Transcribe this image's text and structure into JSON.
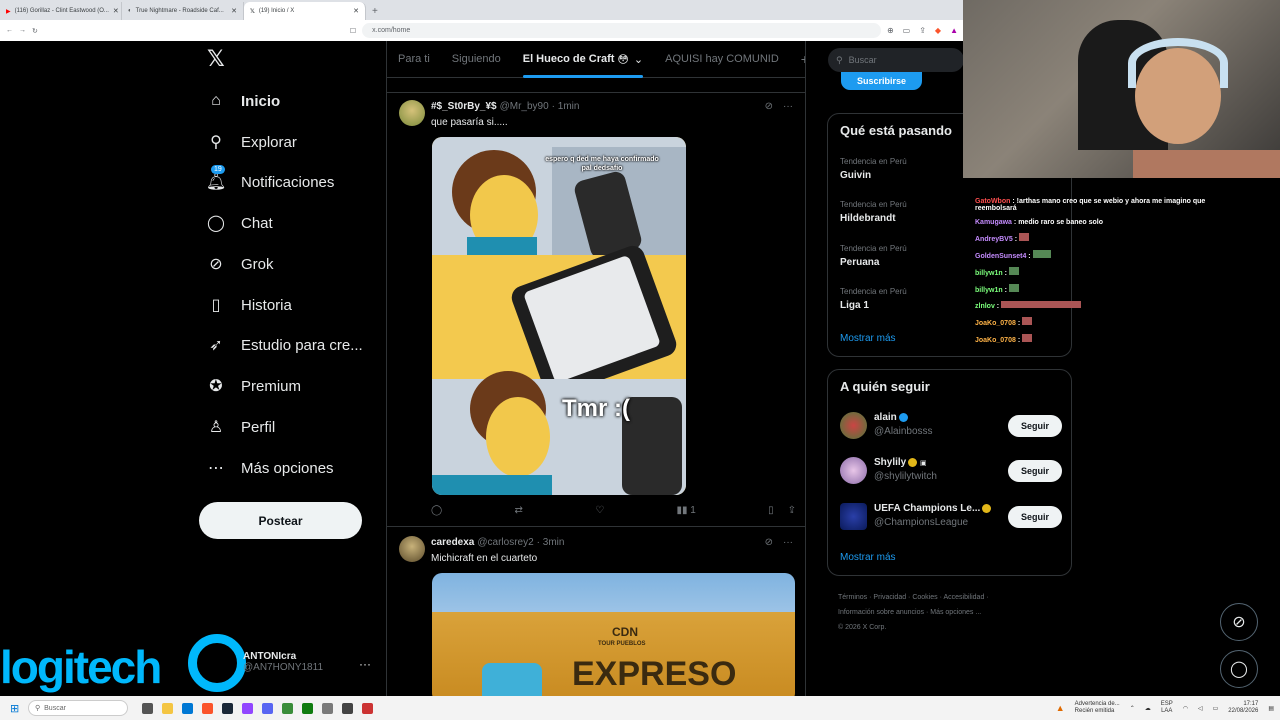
{
  "browser": {
    "tabs": [
      {
        "label": "(116) Gorillaz - Clint Eastwood (O..."
      },
      {
        "label": "True Nightmare - Roadside Caf..."
      },
      {
        "label": "(19) Inicio / X"
      }
    ],
    "url": "x.com/home"
  },
  "nav": {
    "items": [
      {
        "label": "Inicio",
        "icon": "home-icon"
      },
      {
        "label": "Explorar",
        "icon": "search-icon"
      },
      {
        "label": "Notificaciones",
        "icon": "bell-icon",
        "badge": "19"
      },
      {
        "label": "Chat",
        "icon": "chat-icon"
      },
      {
        "label": "Grok",
        "icon": "grok-icon"
      },
      {
        "label": "Historia",
        "icon": "bookmark-icon"
      },
      {
        "label": "Estudio para cre...",
        "icon": "rocket-icon"
      },
      {
        "label": "Premium",
        "icon": "verified-icon"
      },
      {
        "label": "Perfil",
        "icon": "person-icon"
      },
      {
        "label": "Más opciones",
        "icon": "more-icon"
      }
    ],
    "post_button": "Postear",
    "profile_name": "ANTONIcra",
    "profile_handle": "@AN7HONY1811"
  },
  "overlay": {
    "logitech": "logitech"
  },
  "feed": {
    "tabs": [
      "Para ti",
      "Siguiendo",
      "El Hueco de Craft",
      "AQUISI hay COMUNID"
    ],
    "tweets": [
      {
        "name": "#$_St0rBy_¥$",
        "handle": "@Mr_by90",
        "time": "· 1min",
        "text": "que pasaría si.....",
        "meme_top": "espero q ded me haya confirmado pal dedsafio",
        "meme_bottom": "Tmr :(",
        "views": "1"
      },
      {
        "name": "caredexa",
        "handle": "@carlosrey2",
        "time": "· 3min",
        "text": "Michicraft en el cuarteto",
        "sign_text": "CDN",
        "sign_sub": "TOUR PUEBLOS",
        "sign_big": "EXPRESO"
      }
    ]
  },
  "right": {
    "search_placeholder": "Buscar",
    "subscribe": "Suscribirse",
    "trends_title": "Qué está pasando",
    "trends": [
      {
        "context": "Tendencia en Perú",
        "name": "Guivin"
      },
      {
        "context": "Tendencia en Perú",
        "name": "Hildebrandt"
      },
      {
        "context": "Tendencia en Perú",
        "name": "Peruana"
      },
      {
        "context": "Tendencia en Perú",
        "name": "Liga 1"
      }
    ],
    "show_more": "Mostrar más",
    "follow_title": "A quién seguir",
    "follow": [
      {
        "name": "alain",
        "handle": "@Alainbosss",
        "button": "Seguir"
      },
      {
        "name": "Shylily",
        "handle": "@shylilytwitch",
        "button": "Seguir"
      },
      {
        "name": "UEFA Champions Le...",
        "handle": "@ChampionsLeague",
        "button": "Seguir"
      }
    ],
    "follow_more": "Mostrar más",
    "footer": [
      "Términos",
      "Privacidad",
      "Cookies",
      "Accesibilidad",
      "Información sobre anuncios",
      "Más opciones ...",
      "© 2026 X Corp."
    ]
  },
  "stream_chat": [
    {
      "user": "GatoWbon",
      "color": "#ff4f4f",
      "msg": ": !arthas mano creo que se webio y ahora me imagino que reembolsará"
    },
    {
      "user": "Kamugawa",
      "color": "#c58cff",
      "msg": ": medio raro se baneo solo"
    },
    {
      "user": "AndreyBV5",
      "color": "#c58cff",
      "msg": ":"
    },
    {
      "user": "GoldenSunset4",
      "color": "#c58cff",
      "msg": ":"
    },
    {
      "user": "billyw1n",
      "color": "#7cff7c",
      "msg": ":"
    },
    {
      "user": "billyw1n",
      "color": "#7cff7c",
      "msg": ":"
    },
    {
      "user": "zlnlov",
      "color": "#7cff7c",
      "msg": ":"
    },
    {
      "user": "JoaKo_0708",
      "color": "#ffb347",
      "msg": ":"
    },
    {
      "user": "JoaKo_0708",
      "color": "#ffb347",
      "msg": ":"
    }
  ],
  "taskbar": {
    "search": "Buscar",
    "warning": "Advertencia de...",
    "warning_sub": "Recién emitida",
    "lang": "ESP",
    "lang_sub": "LAA",
    "time": "17:17",
    "date": "22/08/2026"
  },
  "colors": {
    "accent": "#1d9bf0",
    "background": "#000000",
    "logitech": "#00b8fc"
  }
}
